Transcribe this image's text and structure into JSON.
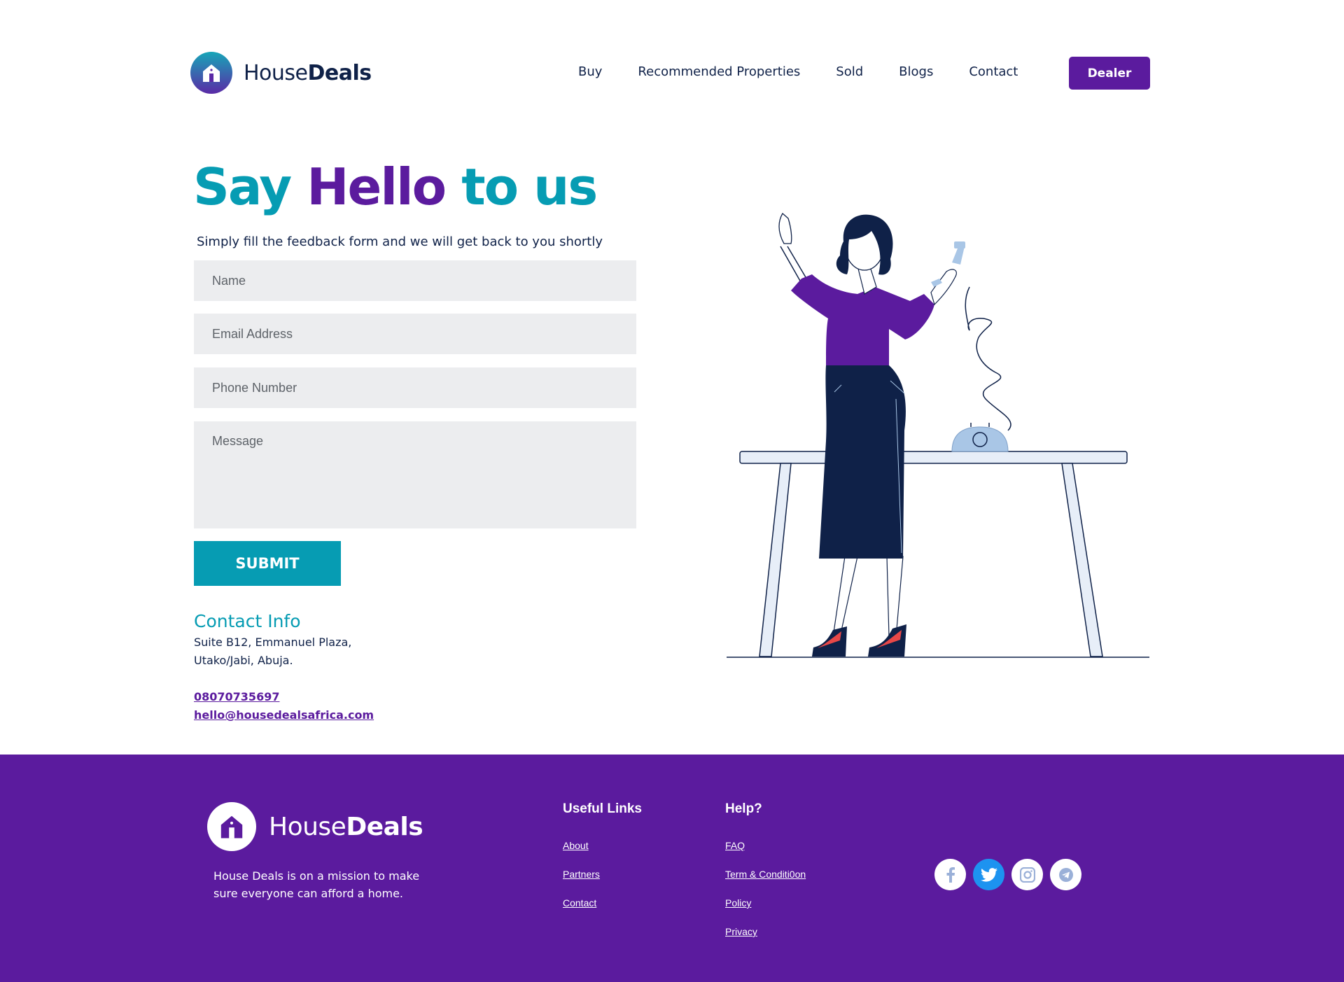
{
  "brand": {
    "name_light": "House",
    "name_bold": "Deals"
  },
  "nav": {
    "items": [
      "Buy",
      "Recommended Properties",
      "Sold",
      "Blogs",
      "Contact"
    ],
    "dealer_label": "Dealer"
  },
  "hero": {
    "title_part1": "Say ",
    "title_part2": "Hello",
    "title_part3": " to us",
    "subtitle": "Simply fill the feedback form and we will get back to you shortly"
  },
  "form": {
    "name_placeholder": "Name",
    "email_placeholder": "Email Address",
    "phone_placeholder": "Phone Number",
    "message_placeholder": "Message",
    "submit_label": "SUBMIT"
  },
  "contact_info": {
    "title": "Contact Info",
    "address_line1": "Suite B12, Emmanuel Plaza,",
    "address_line2": "Utako/Jabi, Abuja.",
    "phone": "08070735697",
    "email": "hello@housedealsafrica.com"
  },
  "footer": {
    "description": "House Deals is on a mission to make sure everyone can afford a home.",
    "useful_links_title": "Useful Links",
    "useful_links": [
      "About",
      "Partners",
      "Contact"
    ],
    "help_title": "Help?",
    "help_links": [
      "FAQ",
      "Term & Conditi0on",
      "Policy",
      "Privacy"
    ],
    "social_icons": [
      "facebook-icon",
      "twitter-icon",
      "instagram-icon",
      "telegram-icon"
    ]
  },
  "colors": {
    "primary_purple": "#5b1b9e",
    "accent_teal": "#069cb3",
    "navy": "#0f2148",
    "field_bg": "#ecedef"
  }
}
